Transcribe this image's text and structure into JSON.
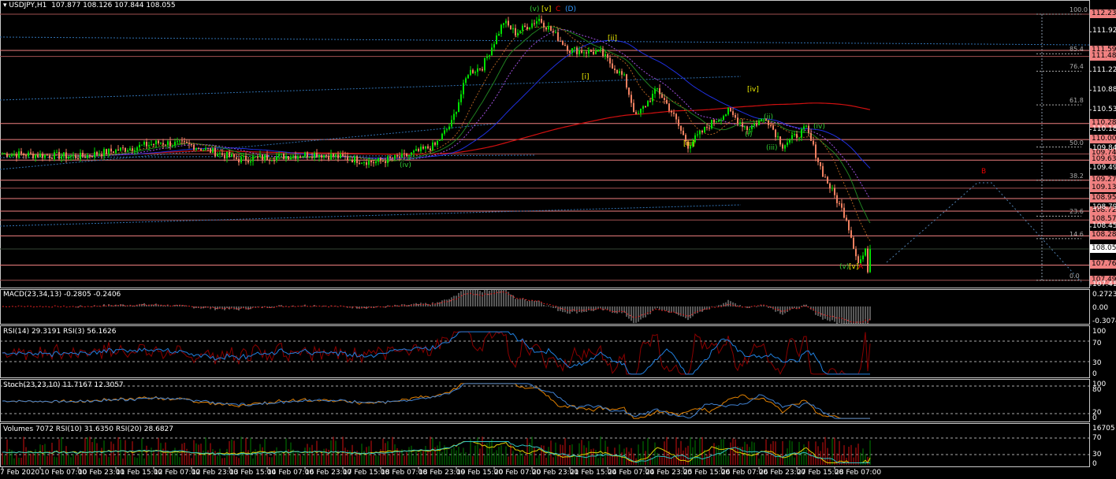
{
  "header": {
    "symbol": "USDJPY,H1",
    "ohlc": "107.877 108.126 107.844 108.055"
  },
  "colors": {
    "bull": "#00e000",
    "bear": "#f08060",
    "level": "#f08080",
    "level_dark": "#a05050",
    "ma_long": "#d01010",
    "ma_mid": "#2030e0",
    "fib": "#8899aa"
  },
  "panels": {
    "macd": {
      "label": "MACD(23,34,13) -0.2805 -0.2406",
      "ticks": [
        "0.2723",
        "0.00",
        "-0.3074"
      ]
    },
    "rsi": {
      "label": "RSI(14) 29.3191  RSI(3) 56.1626",
      "ticks": [
        "100",
        "70",
        "30",
        "0"
      ]
    },
    "stoch": {
      "label": "Stoch(23,23,10) 11.7167 12.3057",
      "ticks": [
        "100",
        "80",
        "20",
        "0"
      ]
    },
    "volumes": {
      "label": "Volumes 7072  RSI(10) 31.6350  RSI(20) 28.6827",
      "ticks": [
        "16705",
        "70",
        "30",
        "0"
      ]
    }
  },
  "chart_data": {
    "type": "candlestick",
    "title": "USDJPY,H1",
    "ylim": [
      107.41,
      112.235
    ],
    "price_path": [
      [
        0,
        109.75
      ],
      [
        33,
        109.7
      ],
      [
        67,
        109.95
      ],
      [
        80,
        109.9
      ],
      [
        100,
        109.65
      ],
      [
        133,
        109.75
      ],
      [
        157,
        109.6
      ],
      [
        170,
        109.7
      ],
      [
        183,
        109.9
      ],
      [
        190,
        110.3
      ],
      [
        197,
        111.2
      ],
      [
        203,
        111.3
      ],
      [
        212,
        112.1
      ],
      [
        217,
        111.9
      ],
      [
        227,
        112.15
      ],
      [
        233,
        111.9
      ],
      [
        240,
        111.6
      ],
      [
        253,
        111.55
      ],
      [
        263,
        111.1
      ],
      [
        268,
        110.4
      ],
      [
        277,
        110.9
      ],
      [
        283,
        110.5
      ],
      [
        290,
        109.9
      ],
      [
        300,
        110.3
      ],
      [
        307,
        110.5
      ],
      [
        315,
        110.2
      ],
      [
        323,
        110.4
      ],
      [
        330,
        109.9
      ],
      [
        340,
        110.2
      ],
      [
        347,
        109.4
      ],
      [
        357,
        108.6
      ],
      [
        362,
        107.8
      ],
      [
        365,
        108.0
      ],
      [
        366,
        107.7
      ],
      [
        367,
        108.055
      ]
    ],
    "price_ticks": [
      "111.920",
      "111.220",
      "110.880",
      "110.530",
      "110.180",
      "109.840",
      "109.490",
      "108.790",
      "108.450",
      "107.410"
    ],
    "levels": [
      "112.235",
      "111.590",
      "111.483",
      "110.289",
      "110.004",
      "109.747",
      "109.636",
      "109.279",
      "109.137",
      "108.953",
      "108.729",
      "108.571",
      "108.288",
      "107.768",
      "107.498"
    ],
    "current_price": "108.055",
    "fib_levels": [
      [
        "100.0",
        112.235
      ],
      [
        "85.4",
        111.53
      ],
      [
        "76.4",
        111.22
      ],
      [
        "61.8",
        110.62
      ],
      [
        "50.0",
        109.87
      ],
      [
        "38.2",
        109.28
      ],
      [
        "23.6",
        108.64
      ],
      [
        "14.6",
        108.24
      ],
      [
        "0.0",
        107.498
      ]
    ],
    "wave_labels": [
      {
        "text": "(v)",
        "i": 223,
        "p": 112.3,
        "color": "#3c3"
      },
      {
        "text": "[v]",
        "i": 228,
        "p": 112.3,
        "color": "#ee0"
      },
      {
        "text": "C",
        "i": 234,
        "p": 112.3,
        "color": "#e00"
      },
      {
        "text": "(D)",
        "i": 238,
        "p": 112.3,
        "color": "#39f"
      },
      {
        "text": "[ii]",
        "i": 256,
        "p": 111.78,
        "color": "#ee0"
      },
      {
        "text": "[i]",
        "i": 245,
        "p": 111.1,
        "color": "#ee0"
      },
      {
        "text": "[iv]",
        "i": 315,
        "p": 110.88,
        "color": "#ee0"
      },
      {
        "text": "(ii)",
        "i": 322,
        "p": 110.38,
        "color": "#3c3"
      },
      {
        "text": "(iv)",
        "i": 343,
        "p": 110.22,
        "color": "#3c3"
      },
      {
        "text": "[iii]",
        "i": 288,
        "p": 109.9,
        "color": "#ee0"
      },
      {
        "text": "(i)",
        "i": 314,
        "p": 110.07,
        "color": "#3c3"
      },
      {
        "text": "(iii)",
        "i": 323,
        "p": 109.84,
        "color": "#3c3"
      },
      {
        "text": "(iv)",
        "i": 168,
        "p": 109.53,
        "color": "#3c3"
      },
      {
        "text": "B",
        "i": 414,
        "p": 109.42,
        "color": "#e00"
      },
      {
        "text": "(v)",
        "i": 354,
        "p": 107.72,
        "color": "#3c3"
      },
      {
        "text": "[v]",
        "i": 358,
        "p": 107.72,
        "color": "#ee0"
      },
      {
        "text": "A",
        "i": 362,
        "p": 107.72,
        "color": "#e00"
      }
    ],
    "time_labels": [
      "7 Feb 2020",
      "10 Feb 07:00",
      "10 Feb 23:00",
      "11 Feb 15:00",
      "12 Feb 07:00",
      "12 Feb 23:00",
      "13 Feb 15:00",
      "14 Feb 07:00",
      "16 Feb 23:00",
      "17 Feb 15:00",
      "18 Feb 07:00",
      "18 Feb 23:00",
      "19 Feb 15:00",
      "20 Feb 07:00",
      "20 Feb 23:00",
      "21 Feb 15:00",
      "24 Feb 07:00",
      "24 Feb 23:00",
      "25 Feb 15:00",
      "26 Feb 07:00",
      "26 Feb 23:00",
      "27 Feb 15:00",
      "28 Feb 07:00"
    ]
  }
}
